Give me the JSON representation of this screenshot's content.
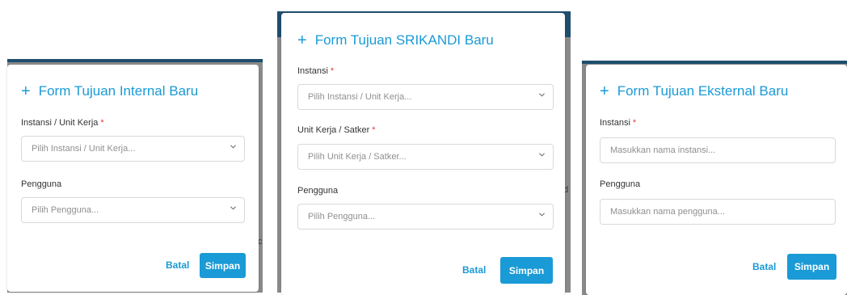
{
  "modals": {
    "internal": {
      "title": "Form Tujuan Internal Baru",
      "field1_label": "Instansi / Unit Kerja",
      "field1_placeholder": "Pilih Instansi / Unit Kerja...",
      "field2_label": "Pengguna",
      "field2_placeholder": "Pilih Pengguna...",
      "cancel": "Batal",
      "save": "Simpan"
    },
    "srikandi": {
      "title": "Form Tujuan SRIKANDI Baru",
      "field1_label": "Instansi",
      "field1_placeholder": "Pilih Instansi / Unit Kerja...",
      "field2_label": "Unit Kerja / Satker",
      "field2_placeholder": "Pilih Unit Kerja / Satker...",
      "field3_label": "Pengguna",
      "field3_placeholder": "Pilih Pengguna...",
      "cancel": "Batal",
      "save": "Simpan"
    },
    "eksternal": {
      "title": "Form Tujuan Eksternal Baru",
      "field1_label": "Instansi",
      "field1_placeholder": "Masukkan nama instansi...",
      "field2_label": "Pengguna",
      "field2_placeholder": "Masukkan nama pengguna...",
      "cancel": "Batal",
      "save": "Simpan"
    }
  },
  "required_mark": "*",
  "icons": {
    "plus": "+",
    "chevron": "chevron-down-icon"
  },
  "colors": {
    "accent": "#1a9ad6",
    "required": "#e53935",
    "backdrop": "#8a8a8a",
    "header_strip": "#1f4e6e"
  }
}
